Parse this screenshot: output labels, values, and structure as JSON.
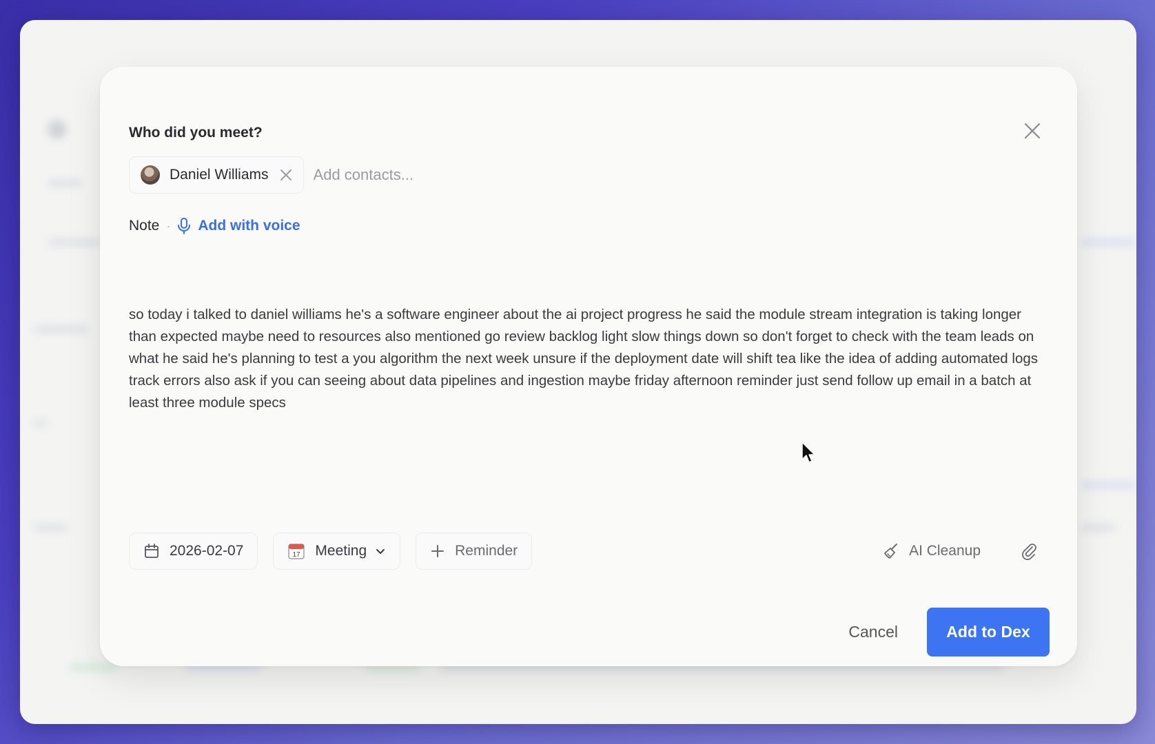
{
  "dialog": {
    "heading": "Who did you meet?",
    "close_icon": "close-icon"
  },
  "contacts": {
    "selected": [
      {
        "name": "Daniel Williams"
      }
    ],
    "placeholder": "Add contacts..."
  },
  "note": {
    "label": "Note",
    "separator": "·",
    "voice_label": "Add with voice",
    "text": "so today i talked to daniel williams he's a software engineer about the ai project progress he said the module stream integration is taking longer than expected maybe need to resources also mentioned go review backlog light slow things down so don't forget to check with the team leads on what he said he's planning to test a you algorithm the next week unsure if the deployment date will shift tea like the idea of adding automated logs track errors also ask if you can seeing about data pipelines and ingestion maybe friday afternoon reminder just send follow up email in a batch at least three module specs"
  },
  "toolbar": {
    "date": "2026-02-07",
    "type": "Meeting",
    "reminder": "Reminder",
    "ai_cleanup": "AI Cleanup"
  },
  "footer": {
    "cancel": "Cancel",
    "submit": "Add to Dex"
  },
  "colors": {
    "accent": "#3d74f2",
    "link": "#3b6fdc"
  }
}
